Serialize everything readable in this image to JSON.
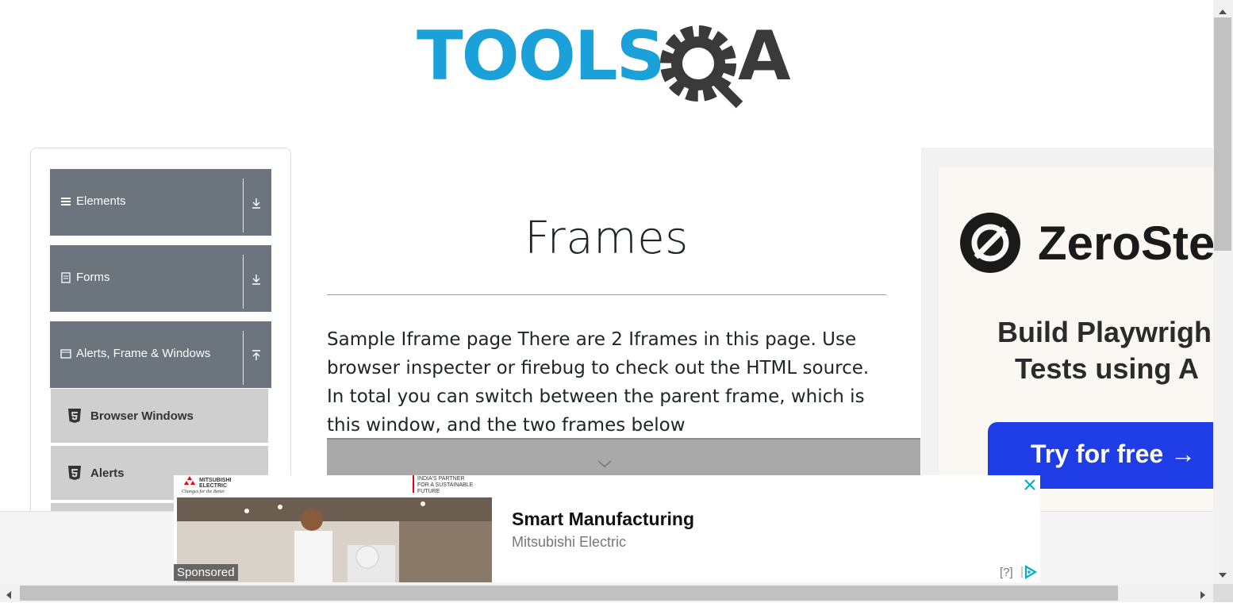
{
  "logo": {
    "text_left": "TOOLS",
    "text_right": "QA",
    "brand_blue": "#1ba1d9",
    "brand_dark": "#3a3a3a"
  },
  "sidebar": {
    "groups": [
      {
        "label": "Elements",
        "icon": "menu-icon",
        "arrow": "download-arrow-icon"
      },
      {
        "label": "Forms",
        "icon": "form-icon",
        "arrow": "download-arrow-icon"
      },
      {
        "label": "Alerts, Frame & Windows",
        "icon": "window-icon",
        "arrow": "upload-arrow-icon"
      }
    ],
    "items": [
      {
        "label": "Browser Windows",
        "icon": "html5-icon"
      },
      {
        "label": "Alerts",
        "icon": "html5-icon"
      }
    ],
    "header_color": "#6c757d",
    "item_color": "#cfcfcf"
  },
  "main": {
    "title": "Frames",
    "description": "Sample Iframe page There are 2 Iframes in this page. Use browser inspecter or firebug to check out the HTML source. In total you can switch between the parent frame, which is this window, and the two frames below"
  },
  "right_ad": {
    "brand": "ZeroSte",
    "tagline_line1": "Build Playwrigh",
    "tagline_line2": "Tests using A",
    "cta": "Try for free →",
    "cta_color": "#1f3de6"
  },
  "bottom_ad": {
    "advertiser_logo": "MITSUBISHI ELECTRIC",
    "advertiser_slogan": "Changes for the Better",
    "banner_text": "INDIA'S PARTNER FOR A SUSTAINABLE FUTURE",
    "headline": "Smart Manufacturing",
    "source": "Mitsubishi Electric",
    "sponsored": "Sponsored",
    "help": "[?]",
    "close_color": "#00aecd"
  }
}
